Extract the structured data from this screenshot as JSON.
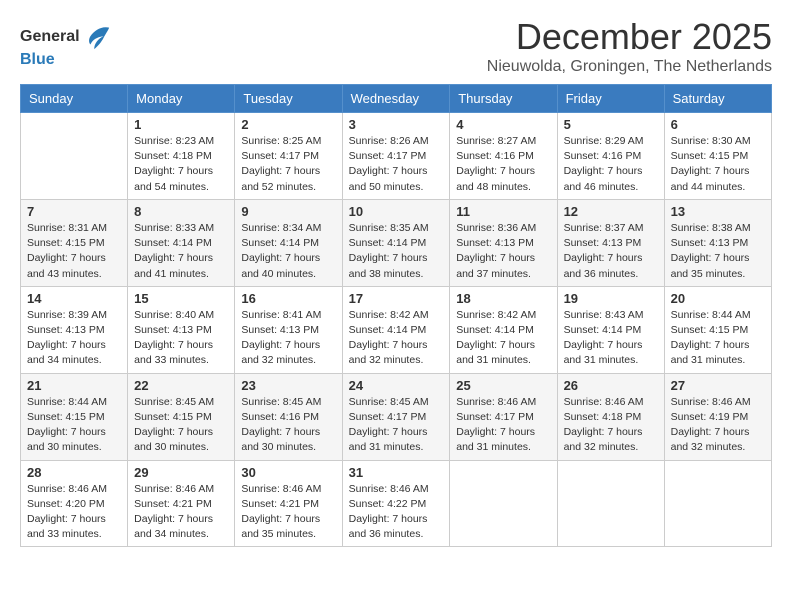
{
  "header": {
    "logo_general": "General",
    "logo_blue": "Blue",
    "month_title": "December 2025",
    "subtitle": "Nieuwolda, Groningen, The Netherlands"
  },
  "days_of_week": [
    "Sunday",
    "Monday",
    "Tuesday",
    "Wednesday",
    "Thursday",
    "Friday",
    "Saturday"
  ],
  "weeks": [
    [
      {
        "day": "",
        "sunrise": "",
        "sunset": "",
        "daylight": ""
      },
      {
        "day": "1",
        "sunrise": "Sunrise: 8:23 AM",
        "sunset": "Sunset: 4:18 PM",
        "daylight": "Daylight: 7 hours and 54 minutes."
      },
      {
        "day": "2",
        "sunrise": "Sunrise: 8:25 AM",
        "sunset": "Sunset: 4:17 PM",
        "daylight": "Daylight: 7 hours and 52 minutes."
      },
      {
        "day": "3",
        "sunrise": "Sunrise: 8:26 AM",
        "sunset": "Sunset: 4:17 PM",
        "daylight": "Daylight: 7 hours and 50 minutes."
      },
      {
        "day": "4",
        "sunrise": "Sunrise: 8:27 AM",
        "sunset": "Sunset: 4:16 PM",
        "daylight": "Daylight: 7 hours and 48 minutes."
      },
      {
        "day": "5",
        "sunrise": "Sunrise: 8:29 AM",
        "sunset": "Sunset: 4:16 PM",
        "daylight": "Daylight: 7 hours and 46 minutes."
      },
      {
        "day": "6",
        "sunrise": "Sunrise: 8:30 AM",
        "sunset": "Sunset: 4:15 PM",
        "daylight": "Daylight: 7 hours and 44 minutes."
      }
    ],
    [
      {
        "day": "7",
        "sunrise": "Sunrise: 8:31 AM",
        "sunset": "Sunset: 4:15 PM",
        "daylight": "Daylight: 7 hours and 43 minutes."
      },
      {
        "day": "8",
        "sunrise": "Sunrise: 8:33 AM",
        "sunset": "Sunset: 4:14 PM",
        "daylight": "Daylight: 7 hours and 41 minutes."
      },
      {
        "day": "9",
        "sunrise": "Sunrise: 8:34 AM",
        "sunset": "Sunset: 4:14 PM",
        "daylight": "Daylight: 7 hours and 40 minutes."
      },
      {
        "day": "10",
        "sunrise": "Sunrise: 8:35 AM",
        "sunset": "Sunset: 4:14 PM",
        "daylight": "Daylight: 7 hours and 38 minutes."
      },
      {
        "day": "11",
        "sunrise": "Sunrise: 8:36 AM",
        "sunset": "Sunset: 4:13 PM",
        "daylight": "Daylight: 7 hours and 37 minutes."
      },
      {
        "day": "12",
        "sunrise": "Sunrise: 8:37 AM",
        "sunset": "Sunset: 4:13 PM",
        "daylight": "Daylight: 7 hours and 36 minutes."
      },
      {
        "day": "13",
        "sunrise": "Sunrise: 8:38 AM",
        "sunset": "Sunset: 4:13 PM",
        "daylight": "Daylight: 7 hours and 35 minutes."
      }
    ],
    [
      {
        "day": "14",
        "sunrise": "Sunrise: 8:39 AM",
        "sunset": "Sunset: 4:13 PM",
        "daylight": "Daylight: 7 hours and 34 minutes."
      },
      {
        "day": "15",
        "sunrise": "Sunrise: 8:40 AM",
        "sunset": "Sunset: 4:13 PM",
        "daylight": "Daylight: 7 hours and 33 minutes."
      },
      {
        "day": "16",
        "sunrise": "Sunrise: 8:41 AM",
        "sunset": "Sunset: 4:13 PM",
        "daylight": "Daylight: 7 hours and 32 minutes."
      },
      {
        "day": "17",
        "sunrise": "Sunrise: 8:42 AM",
        "sunset": "Sunset: 4:14 PM",
        "daylight": "Daylight: 7 hours and 32 minutes."
      },
      {
        "day": "18",
        "sunrise": "Sunrise: 8:42 AM",
        "sunset": "Sunset: 4:14 PM",
        "daylight": "Daylight: 7 hours and 31 minutes."
      },
      {
        "day": "19",
        "sunrise": "Sunrise: 8:43 AM",
        "sunset": "Sunset: 4:14 PM",
        "daylight": "Daylight: 7 hours and 31 minutes."
      },
      {
        "day": "20",
        "sunrise": "Sunrise: 8:44 AM",
        "sunset": "Sunset: 4:15 PM",
        "daylight": "Daylight: 7 hours and 31 minutes."
      }
    ],
    [
      {
        "day": "21",
        "sunrise": "Sunrise: 8:44 AM",
        "sunset": "Sunset: 4:15 PM",
        "daylight": "Daylight: 7 hours and 30 minutes."
      },
      {
        "day": "22",
        "sunrise": "Sunrise: 8:45 AM",
        "sunset": "Sunset: 4:15 PM",
        "daylight": "Daylight: 7 hours and 30 minutes."
      },
      {
        "day": "23",
        "sunrise": "Sunrise: 8:45 AM",
        "sunset": "Sunset: 4:16 PM",
        "daylight": "Daylight: 7 hours and 30 minutes."
      },
      {
        "day": "24",
        "sunrise": "Sunrise: 8:45 AM",
        "sunset": "Sunset: 4:17 PM",
        "daylight": "Daylight: 7 hours and 31 minutes."
      },
      {
        "day": "25",
        "sunrise": "Sunrise: 8:46 AM",
        "sunset": "Sunset: 4:17 PM",
        "daylight": "Daylight: 7 hours and 31 minutes."
      },
      {
        "day": "26",
        "sunrise": "Sunrise: 8:46 AM",
        "sunset": "Sunset: 4:18 PM",
        "daylight": "Daylight: 7 hours and 32 minutes."
      },
      {
        "day": "27",
        "sunrise": "Sunrise: 8:46 AM",
        "sunset": "Sunset: 4:19 PM",
        "daylight": "Daylight: 7 hours and 32 minutes."
      }
    ],
    [
      {
        "day": "28",
        "sunrise": "Sunrise: 8:46 AM",
        "sunset": "Sunset: 4:20 PM",
        "daylight": "Daylight: 7 hours and 33 minutes."
      },
      {
        "day": "29",
        "sunrise": "Sunrise: 8:46 AM",
        "sunset": "Sunset: 4:21 PM",
        "daylight": "Daylight: 7 hours and 34 minutes."
      },
      {
        "day": "30",
        "sunrise": "Sunrise: 8:46 AM",
        "sunset": "Sunset: 4:21 PM",
        "daylight": "Daylight: 7 hours and 35 minutes."
      },
      {
        "day": "31",
        "sunrise": "Sunrise: 8:46 AM",
        "sunset": "Sunset: 4:22 PM",
        "daylight": "Daylight: 7 hours and 36 minutes."
      },
      {
        "day": "",
        "sunrise": "",
        "sunset": "",
        "daylight": ""
      },
      {
        "day": "",
        "sunrise": "",
        "sunset": "",
        "daylight": ""
      },
      {
        "day": "",
        "sunrise": "",
        "sunset": "",
        "daylight": ""
      }
    ]
  ]
}
